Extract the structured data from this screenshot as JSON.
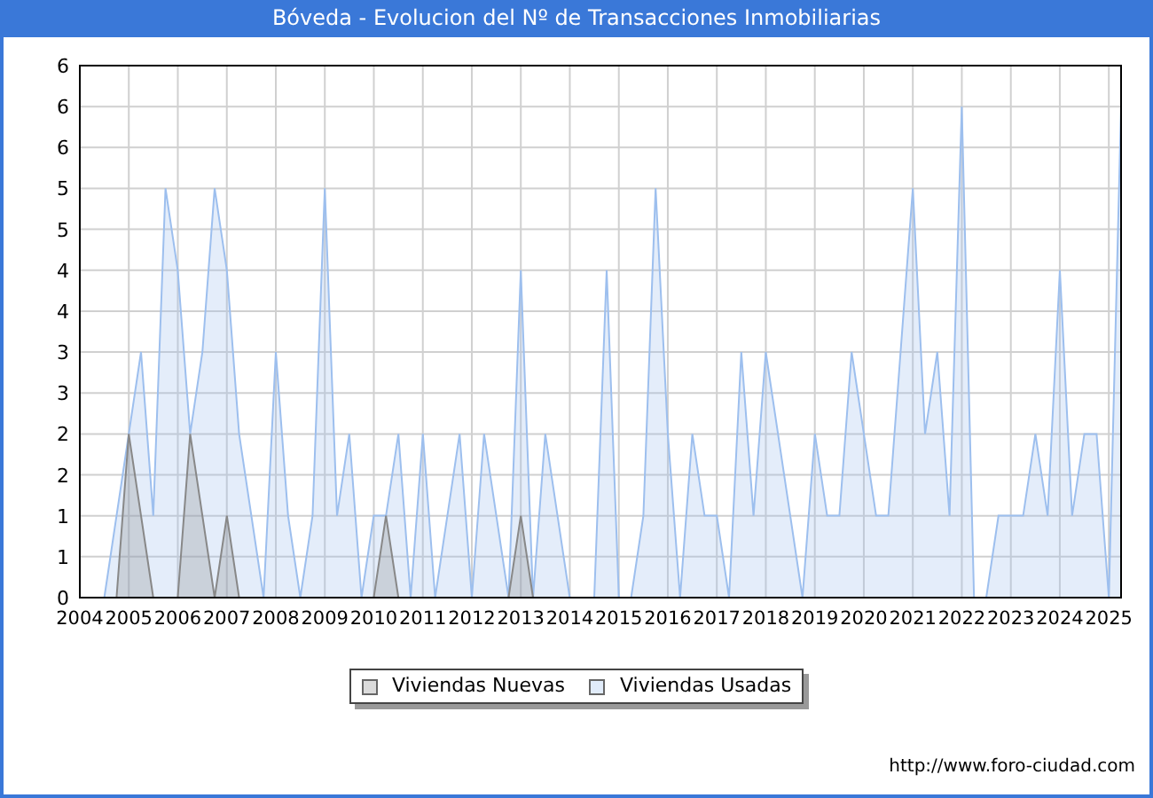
{
  "header": {
    "title": "Bóveda - Evolucion del Nº de Transacciones Inmobiliarias"
  },
  "chart": {
    "chart_data": {
      "type": "area",
      "x": [
        2004.5,
        2004.75,
        2005,
        2005.25,
        2005.5,
        2005.75,
        2006,
        2006.25,
        2006.5,
        2006.75,
        2007,
        2007.25,
        2007.5,
        2007.75,
        2008,
        2008.25,
        2008.5,
        2008.75,
        2009,
        2009.25,
        2009.5,
        2009.75,
        2010,
        2010.25,
        2010.5,
        2010.75,
        2011,
        2011.25,
        2011.5,
        2011.75,
        2012,
        2012.25,
        2012.5,
        2012.75,
        2013,
        2013.25,
        2013.5,
        2013.75,
        2014,
        2014.25,
        2014.5,
        2014.75,
        2015,
        2015.25,
        2015.5,
        2015.75,
        2016,
        2016.25,
        2016.5,
        2016.75,
        2017,
        2017.25,
        2017.5,
        2017.75,
        2018,
        2018.25,
        2018.5,
        2018.75,
        2019,
        2019.25,
        2019.5,
        2019.75,
        2020,
        2020.25,
        2020.5,
        2020.75,
        2021,
        2021.25,
        2021.5,
        2021.75,
        2022,
        2022.25,
        2022.5,
        2022.75,
        2023,
        2023.25,
        2023.5,
        2023.75,
        2024,
        2024.25,
        2024.5,
        2024.75,
        2025,
        2025.25
      ],
      "series": [
        {
          "name": "Viviendas Usadas",
          "color": "#9dbfee",
          "values": [
            0,
            1,
            2,
            3,
            1,
            5,
            4,
            2,
            3,
            5,
            4,
            2,
            1,
            0,
            3,
            1,
            0,
            1,
            5,
            1,
            2,
            0,
            1,
            1,
            2,
            0,
            2,
            0,
            1,
            2,
            0,
            2,
            1,
            0,
            4,
            0,
            2,
            1,
            0,
            0,
            0,
            4,
            0,
            0,
            1,
            5,
            2,
            0,
            2,
            1,
            1,
            0,
            3,
            1,
            3,
            2,
            1,
            0,
            2,
            1,
            1,
            3,
            2,
            1,
            1,
            3,
            5,
            2,
            3,
            1,
            6,
            0,
            0,
            1,
            1,
            1,
            2,
            1,
            4,
            1,
            2,
            2,
            0,
            6
          ]
        },
        {
          "name": "Viviendas Nuevas",
          "color": "#888888",
          "values": [
            null,
            0,
            2,
            1,
            0,
            null,
            0,
            2,
            1,
            0,
            1,
            0,
            null,
            null,
            null,
            null,
            null,
            null,
            null,
            null,
            null,
            null,
            0,
            1,
            0,
            null,
            null,
            null,
            null,
            null,
            null,
            null,
            null,
            0,
            1,
            0,
            null,
            null,
            null,
            null,
            null,
            null,
            null,
            null,
            null,
            null,
            null,
            null,
            null,
            null,
            null,
            null,
            null,
            null,
            null,
            null,
            null,
            null,
            null,
            null,
            null,
            null,
            null,
            null,
            null,
            null,
            null,
            null,
            null,
            null,
            null,
            null,
            null,
            null,
            null,
            null,
            null,
            null,
            null,
            null,
            null,
            null,
            null,
            null
          ]
        }
      ],
      "grid": true,
      "xlim": [
        2004,
        2025.25
      ],
      "ylim": [
        0,
        6.5
      ],
      "xticks": [
        2004,
        2005,
        2006,
        2007,
        2008,
        2009,
        2010,
        2011,
        2012,
        2013,
        2014,
        2015,
        2016,
        2017,
        2018,
        2019,
        2020,
        2021,
        2022,
        2023,
        2024,
        2025
      ],
      "yticks": [
        {
          "value": 0,
          "label": "0"
        },
        {
          "value": 0.5,
          "label": "1"
        },
        {
          "value": 1,
          "label": "1"
        },
        {
          "value": 1.5,
          "label": "2"
        },
        {
          "value": 2,
          "label": "2"
        },
        {
          "value": 2.5,
          "label": "3"
        },
        {
          "value": 3,
          "label": "3"
        },
        {
          "value": 3.5,
          "label": "4"
        },
        {
          "value": 4,
          "label": "4"
        },
        {
          "value": 4.5,
          "label": "5"
        },
        {
          "value": 5,
          "label": "5"
        },
        {
          "value": 5.5,
          "label": "6"
        },
        {
          "value": 6,
          "label": "6"
        },
        {
          "value": 6.5,
          "label": "6"
        }
      ]
    }
  },
  "source": "http://www.foro-ciudad.com"
}
